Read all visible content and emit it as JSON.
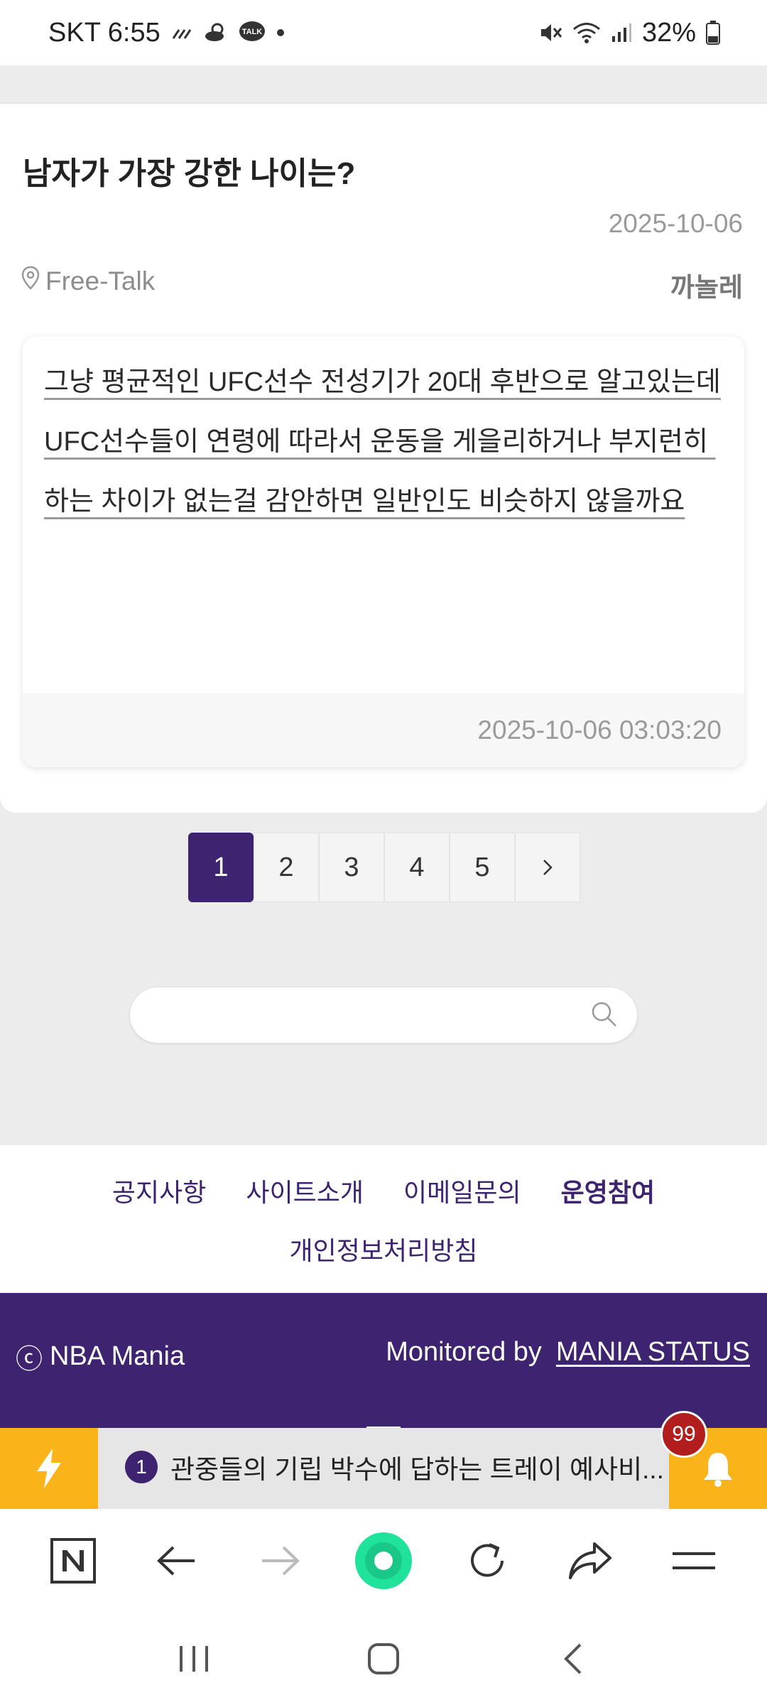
{
  "status_bar": {
    "carrier_time": "SKT 6:55",
    "battery": "32%",
    "icons": [
      "signal-strength-icon",
      "weather-icon",
      "kakaotalk-icon",
      "dot-icon",
      "mute-icon",
      "wifi-icon",
      "cell-signal-icon",
      "battery-icon"
    ],
    "talk_label": "TALK"
  },
  "post": {
    "title": "남자가 가장 강한 나이는?",
    "date": "2025-10-06",
    "board": "Free-Talk",
    "author": "까놀레",
    "comment": {
      "text": "그냥 평균적인 UFC선수 전성기가 20대 후반으로 알고있는데\nUFC선수들이 연령에 따라서 운동을 게을리하거나 부지런히 하는 차이가 없는걸 감안하면 일반인도 비슷하지 않을까요",
      "timestamp": "2025-10-06 03:03:20"
    }
  },
  "pagination": {
    "pages": [
      "1",
      "2",
      "3",
      "4",
      "5"
    ],
    "active": "1",
    "next_label": "›"
  },
  "search": {
    "placeholder": ""
  },
  "footer": {
    "links": [
      "공지사항",
      "사이트소개",
      "이메일문의",
      "운영참여"
    ],
    "privacy": "개인정보처리방침",
    "copyright_symbol": "ⓒ",
    "brand": "NBA Mania",
    "monitored_label": "Monitored by",
    "monitored_link": "MANIA STATUS"
  },
  "ticker": {
    "rank": "1",
    "text": "관중들의 기립 박수에 답하는 트레이 예사비...",
    "badge_count": "99"
  },
  "colors": {
    "brand_purple": "#3d2370",
    "accent_yellow": "#fbb31a",
    "badge_red": "#b21e1e",
    "browser_green": "#1fe39a"
  }
}
